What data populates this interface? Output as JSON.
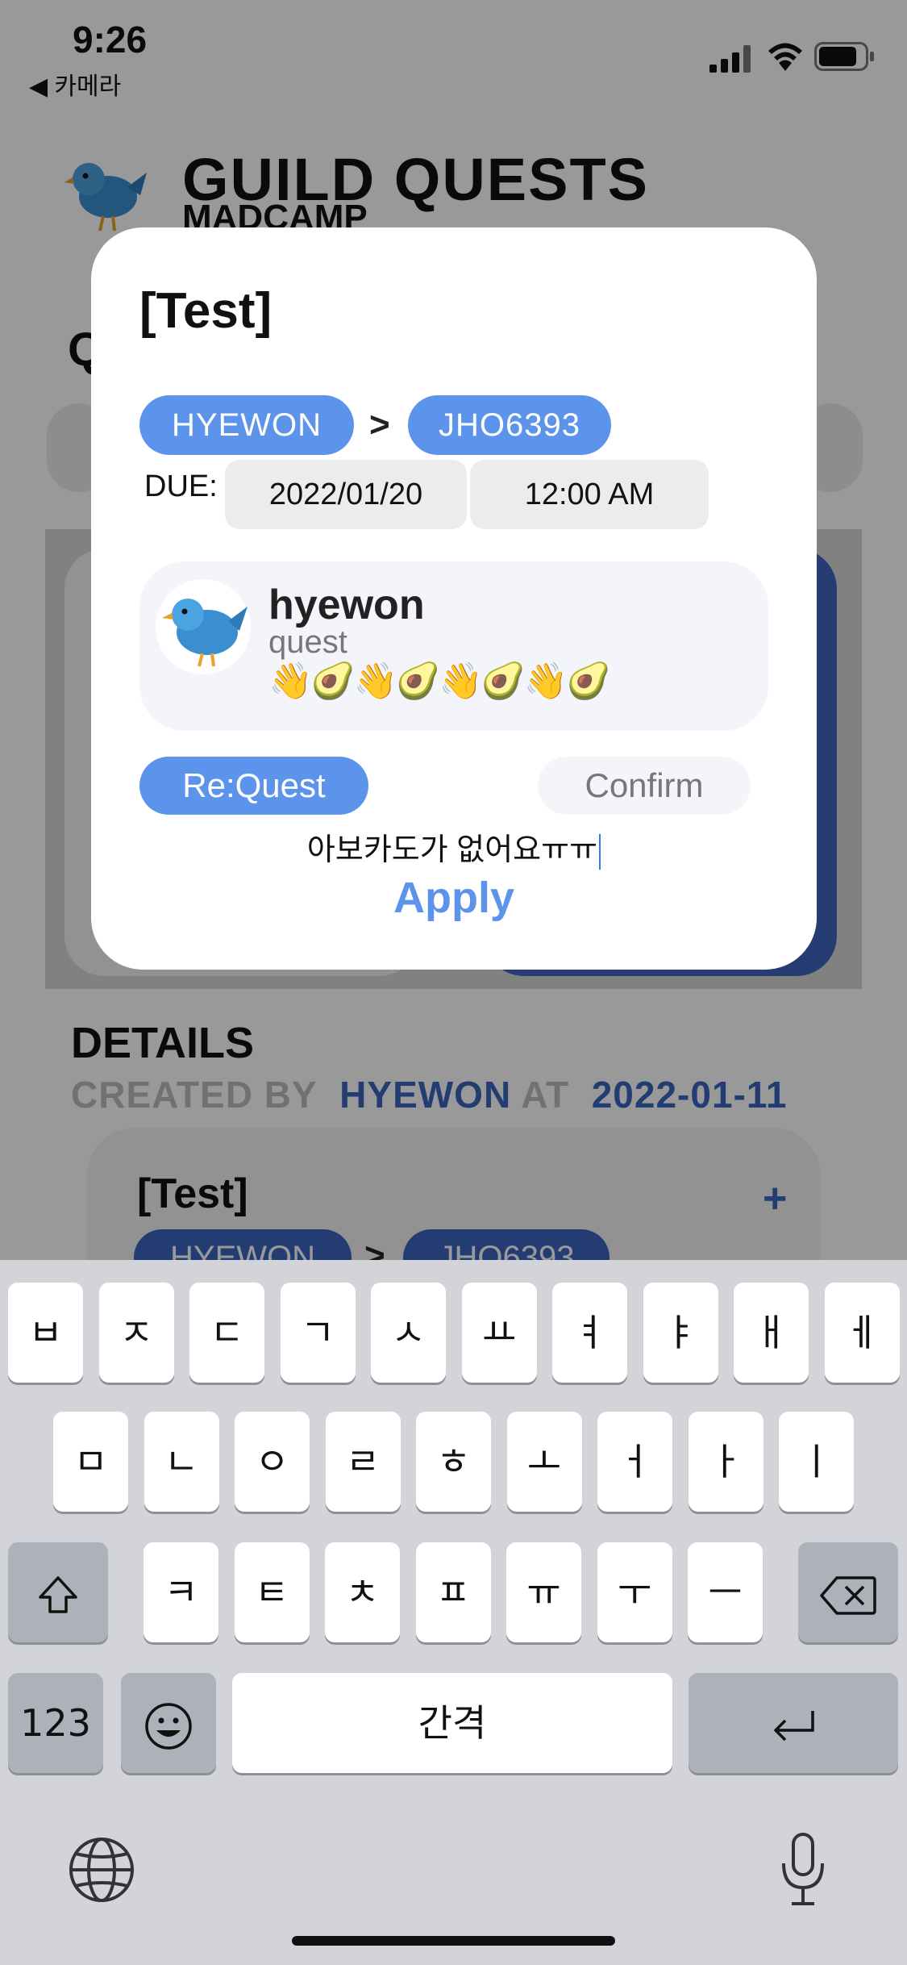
{
  "status_bar": {
    "time": "9:26",
    "back_label": "◀ 카메라"
  },
  "header": {
    "title": "GUILD QUESTS",
    "subtitle": "MADCAMP"
  },
  "background": {
    "section_letter": "Q",
    "details_heading": "DETAILS",
    "created_by_prefix": "CREATED BY",
    "created_by_user": "HYEWON",
    "created_at_prefix": "AT",
    "created_date": "2022-01-11",
    "card_title": "[Test]",
    "card_plus": "+",
    "card_from": "HYEWON",
    "card_arrow": ">",
    "card_to": "JHO6393"
  },
  "modal": {
    "title": "[Test]",
    "from_user": "HYEWON",
    "arrow": ">",
    "to_user": "JHO6393",
    "due_label": "DUE:",
    "due_date": "2022/01/20",
    "due_time": "12:00 AM",
    "message": {
      "author": "hyewon",
      "type": "quest",
      "content": "👋🥑👋🥑👋🥑👋🥑"
    },
    "request_button": "Re:Quest",
    "confirm_button": "Confirm",
    "reply_text": "아보카도가 없어요ㅠㅠ",
    "apply_button": "Apply"
  },
  "keyboard": {
    "row1": [
      "ㅂ",
      "ㅈ",
      "ㄷ",
      "ㄱ",
      "ㅅ",
      "ㅛ",
      "ㅕ",
      "ㅑ",
      "ㅐ",
      "ㅔ"
    ],
    "row2": [
      "ㅁ",
      "ㄴ",
      "ㅇ",
      "ㄹ",
      "ㅎ",
      "ㅗ",
      "ㅓ",
      "ㅏ",
      "ㅣ"
    ],
    "row3": [
      "ㅋ",
      "ㅌ",
      "ㅊ",
      "ㅍ",
      "ㅠ",
      "ㅜ",
      "ㅡ"
    ],
    "numbers_key": "123",
    "space_key": "간격"
  },
  "colors": {
    "accent": "#5b94ea",
    "dark_accent": "#3b67bf"
  }
}
